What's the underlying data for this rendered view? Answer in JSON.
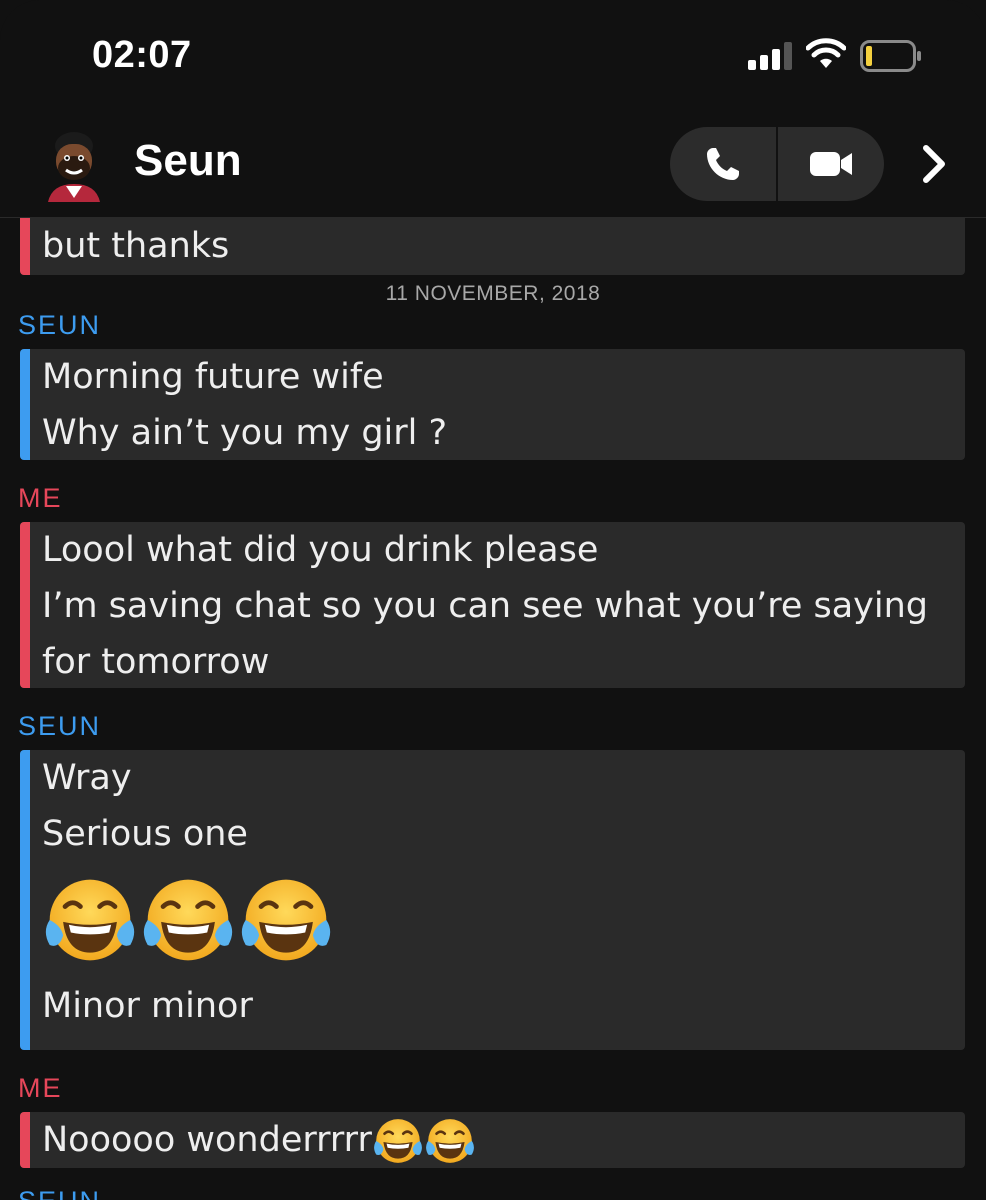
{
  "status_bar": {
    "time": "02:07"
  },
  "header": {
    "contact_name": "Seun",
    "icons": [
      "phone-icon",
      "video-camera-icon",
      "chevron-right-icon"
    ]
  },
  "colors": {
    "background": "#111111",
    "bubble": "#2a2a2a",
    "me_accent": "#e6475a",
    "them_accent": "#3d9cf0"
  },
  "chat": {
    "partial_message": {
      "sender": "me",
      "lines": [
        "but thanks"
      ]
    },
    "date_separator": "11 NOVEMBER, 2018",
    "groups": [
      {
        "sender_label": "SEUN",
        "sender": "them",
        "lines": [
          "Morning future wife",
          "Why ain’t you my girl ?"
        ]
      },
      {
        "sender_label": "ME",
        "sender": "me",
        "lines": [
          "Loool what did you drink please",
          "I’m saving chat so you can see what you’re saying",
          "for tomorrow"
        ]
      },
      {
        "sender_label": "SEUN",
        "sender": "them",
        "lines": [
          "Wray",
          "Serious one",
          "Minor minor"
        ],
        "emoji_count": 3,
        "emoji": "face-with-tears-of-joy"
      },
      {
        "sender_label": "ME",
        "sender": "me",
        "lines": [
          "Nooooo wonderrrrr"
        ],
        "trailing_emoji_count": 2,
        "emoji": "face-with-tears-of-joy"
      },
      {
        "sender_label": "SEUN",
        "sender": "them"
      }
    ]
  }
}
